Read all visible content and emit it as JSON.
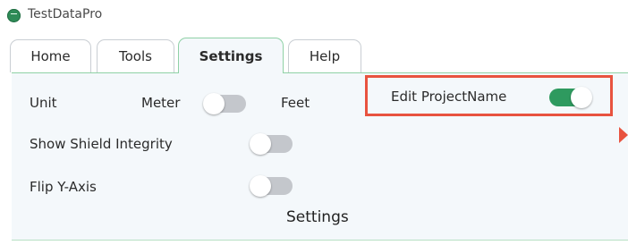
{
  "app": {
    "title": "TestDataPro",
    "logo_icon": "app-logo-icon",
    "accent": "#2e9a5f"
  },
  "tabs": [
    {
      "label": "Home",
      "active": false
    },
    {
      "label": "Tools",
      "active": false
    },
    {
      "label": "Settings",
      "active": true
    },
    {
      "label": "Help",
      "active": false
    }
  ],
  "settings": {
    "unit": {
      "label": "Unit",
      "left_option": "Meter",
      "right_option": "Feet",
      "value": "Meter"
    },
    "show_shield_integrity": {
      "label": "Show Shield Integrity",
      "enabled": false
    },
    "flip_y_axis": {
      "label": "Flip Y-Axis",
      "enabled": false
    },
    "edit_project_name": {
      "label": "Edit ProjectName",
      "enabled": true
    },
    "group_label": "Settings"
  },
  "annotation": {
    "highlight_color": "#e8533f"
  }
}
